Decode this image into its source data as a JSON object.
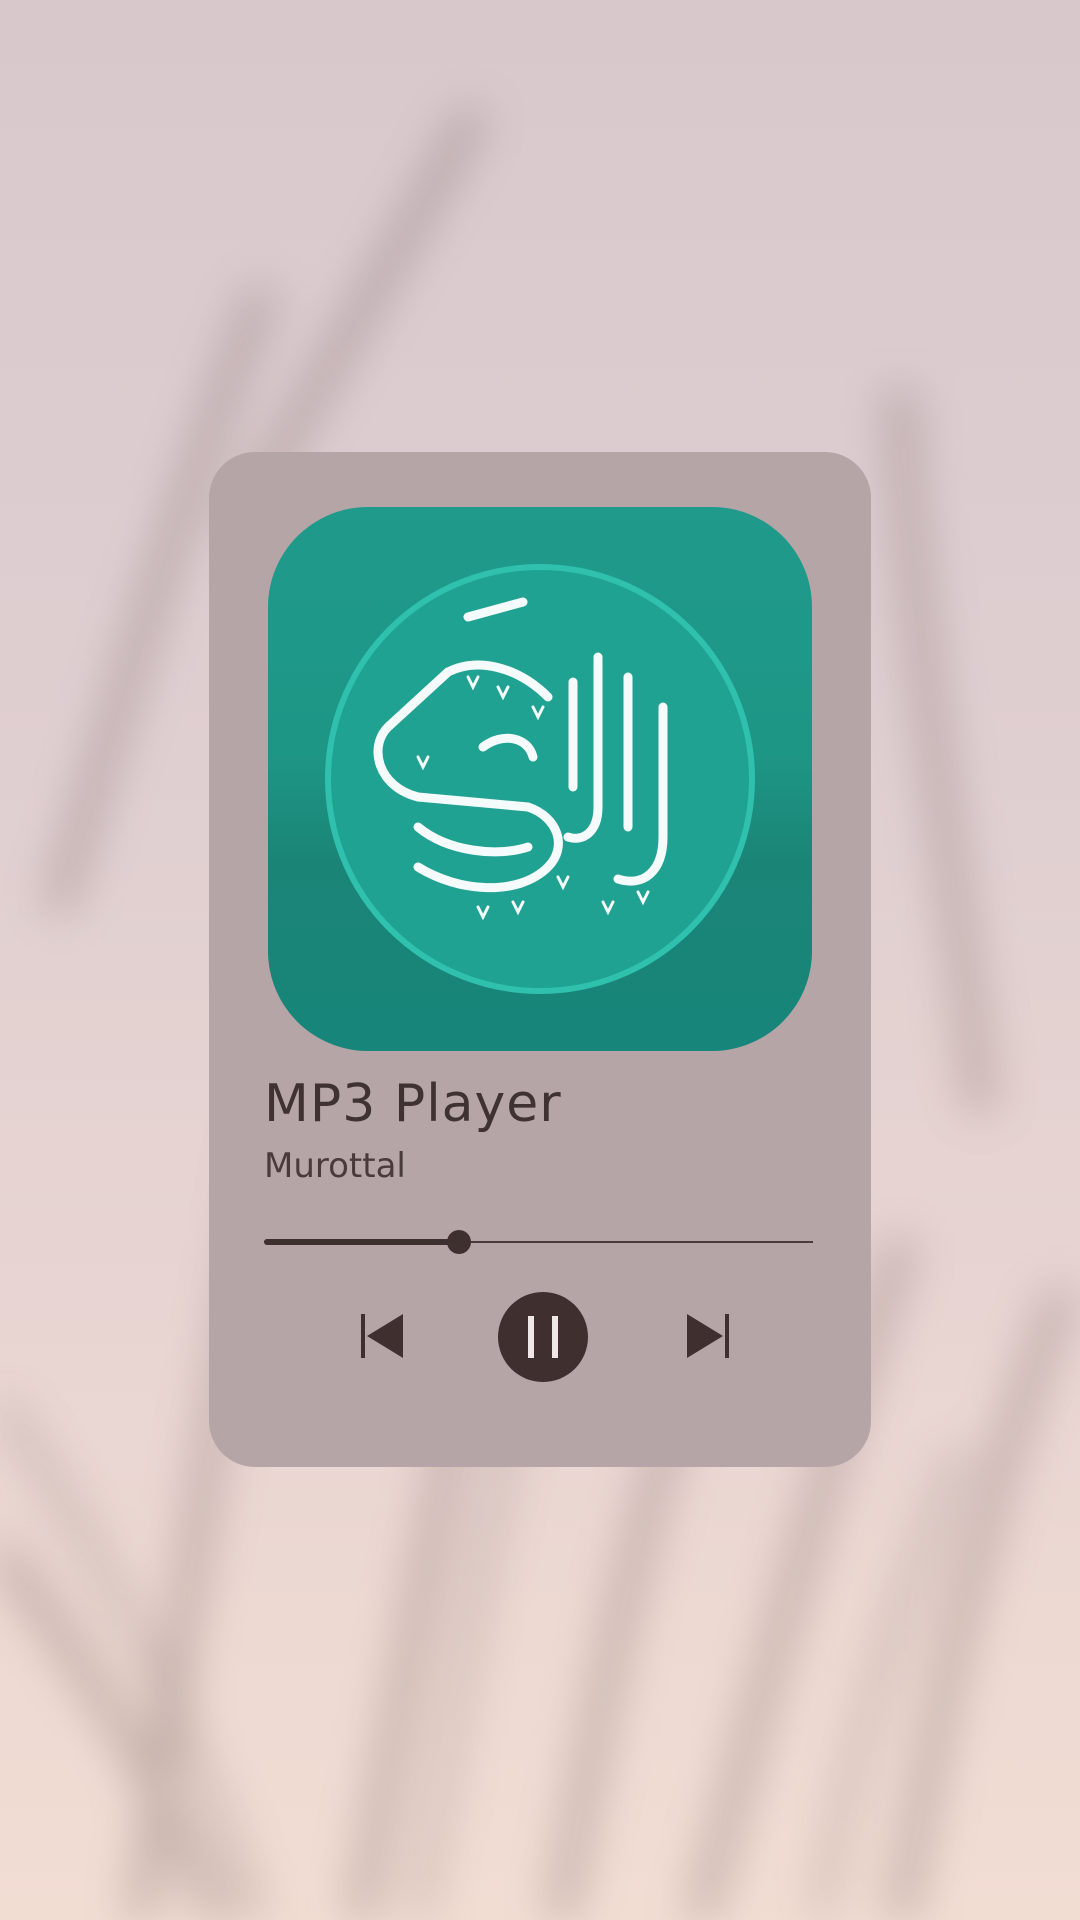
{
  "player": {
    "title": "MP3 Player",
    "subtitle": "Murottal",
    "progress_fraction": 0.355,
    "controls": {
      "previous_icon": "skip-previous-icon",
      "play_pause_icon": "pause-icon",
      "next_icon": "skip-next-icon"
    },
    "album_art": "quran-calligraphy-icon"
  },
  "colors": {
    "card_background": "#b5a5a7",
    "art_teal": "#1f9a8b",
    "controls_dark": "#3f302f",
    "background": "#e0cfd1"
  }
}
